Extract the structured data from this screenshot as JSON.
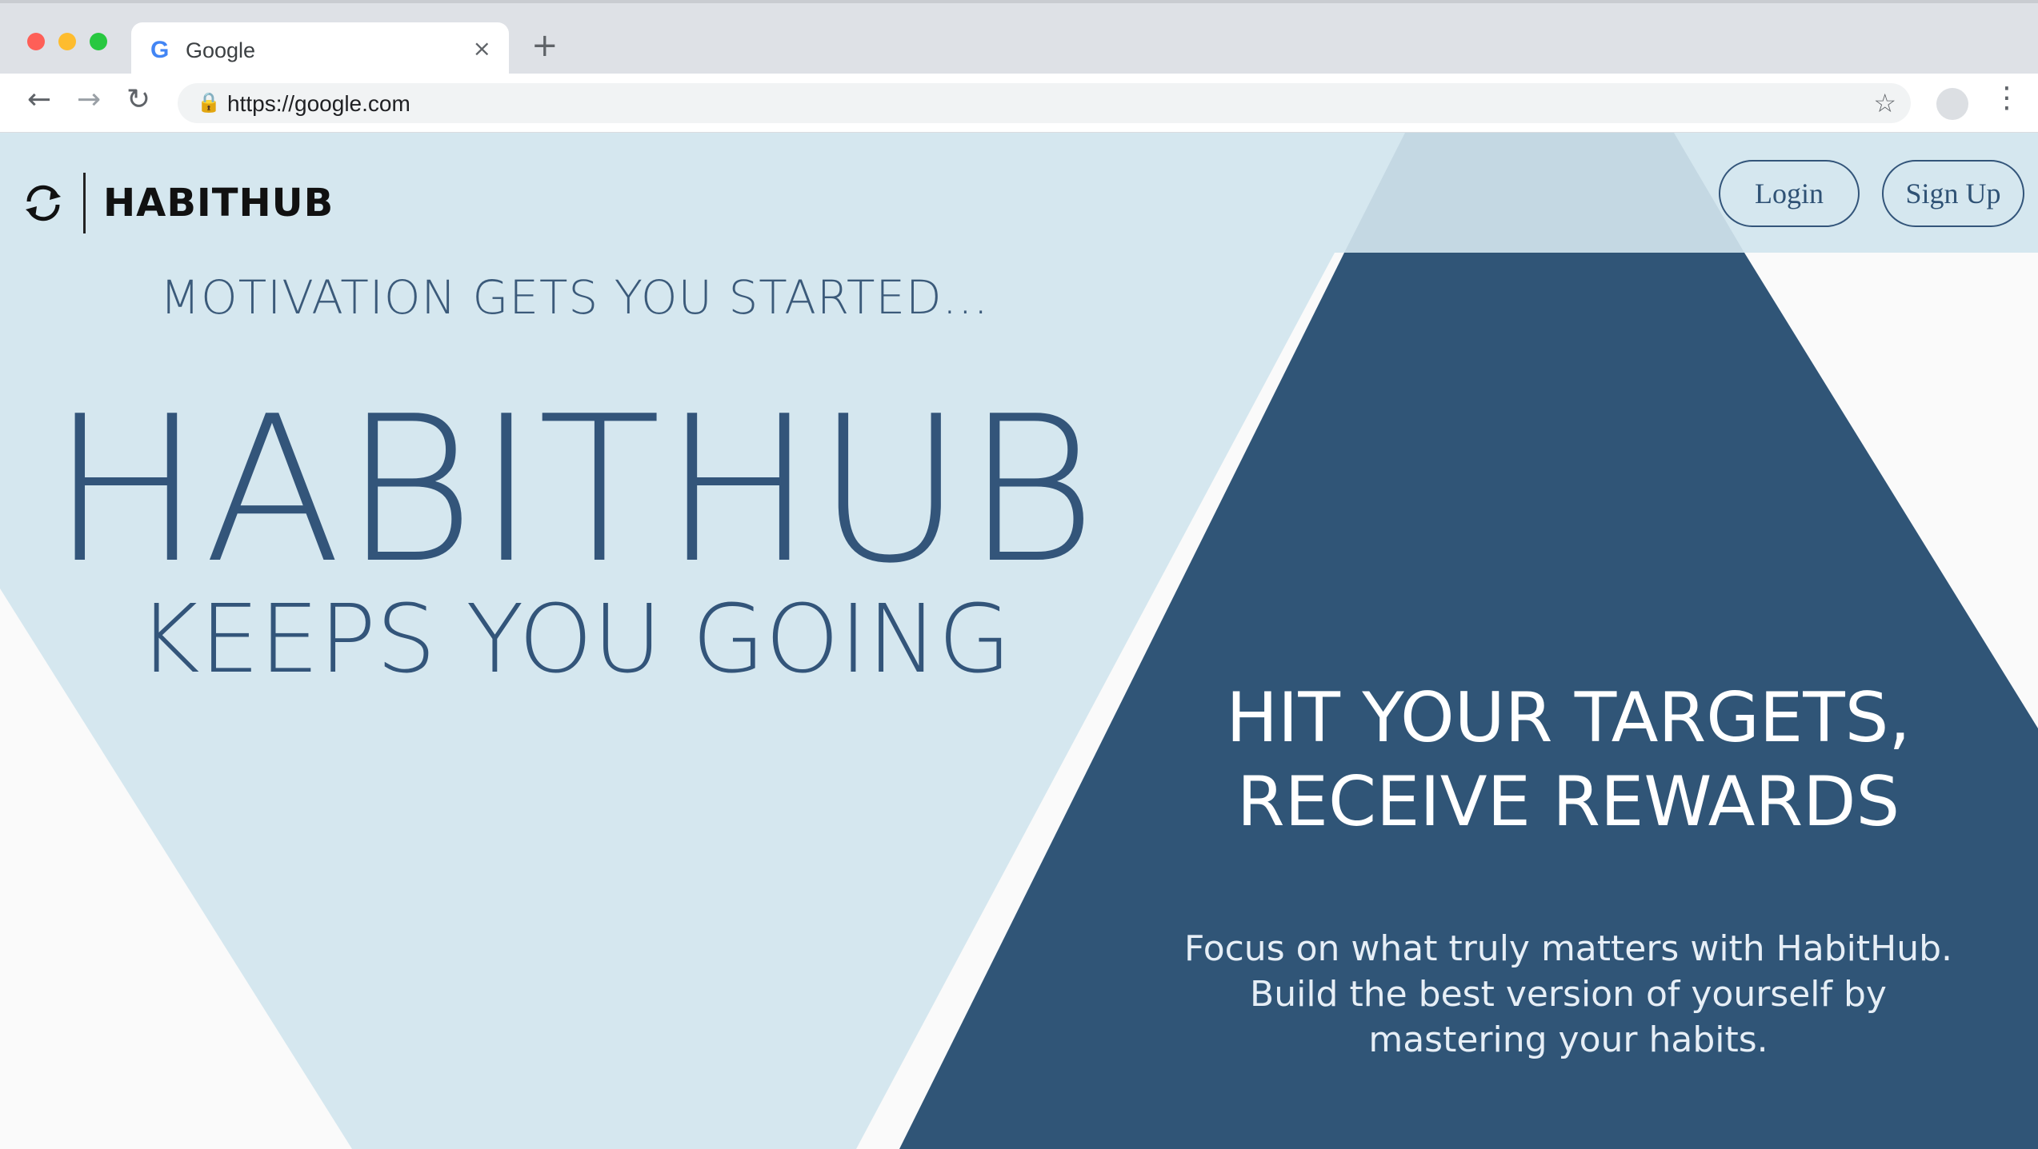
{
  "browser": {
    "tab_title": "Google",
    "tab_favicon": "G",
    "close_glyph": "×",
    "new_tab_glyph": "+",
    "url": "https://google.com",
    "icons": [
      "back-arrow-icon",
      "forward-arrow-icon",
      "reload-icon",
      "lock-icon",
      "star-icon",
      "profile-avatar",
      "menu-dots-icon"
    ]
  },
  "header": {
    "brand_name": "HABITHUB",
    "login_label": "Login",
    "signup_label": "Sign Up"
  },
  "hero": {
    "tagline": "MOTIVATION GETS YOU STARTED...",
    "title": "HABITHUB",
    "subtitle": "KEEPS YOU GOING"
  },
  "promo": {
    "heading_line1": "HIT YOUR TARGETS,",
    "heading_line2": "RECEIVE REWARDS",
    "body_line1": "Focus on what truly matters with HabitHub.",
    "body_line2": "Build the best version of yourself by",
    "body_line3": "mastering your habits."
  },
  "colors": {
    "light_panel": "#d5e7ef",
    "dark_panel": "#305577",
    "text_blue": "#33557a",
    "header_strip": "#d5e7ef"
  }
}
